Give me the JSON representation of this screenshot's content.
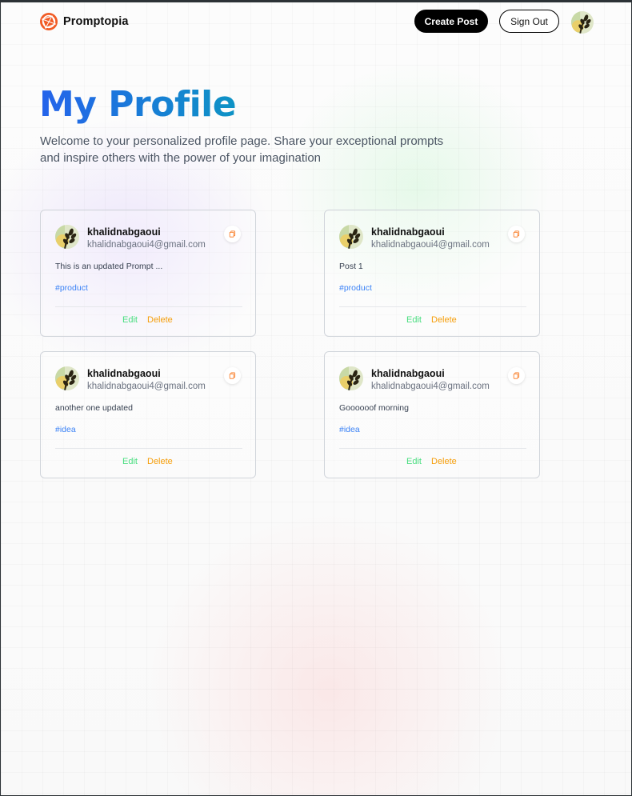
{
  "app": {
    "name": "Promptopia"
  },
  "nav": {
    "create_post_label": "Create Post",
    "sign_out_label": "Sign Out",
    "avatar_icon": "user-avatar-icon"
  },
  "header": {
    "title": "My Profile",
    "description": "Welcome to your personalized profile page. Share your exceptional prompts and inspire others with the power of your imagination"
  },
  "posts": [
    {
      "username": "khalidnabgaoui",
      "email": "khalidnabgaoui4@gmail.com",
      "prompt": "This is an updated Prompt ...",
      "tag": "#product",
      "edit_label": "Edit",
      "delete_label": "Delete"
    },
    {
      "username": "khalidnabgaoui",
      "email": "khalidnabgaoui4@gmail.com",
      "prompt": "Post 1",
      "tag": "#product",
      "edit_label": "Edit",
      "delete_label": "Delete"
    },
    {
      "username": "khalidnabgaoui",
      "email": "khalidnabgaoui4@gmail.com",
      "prompt": "another one updated",
      "tag": "#idea",
      "edit_label": "Edit",
      "delete_label": "Delete"
    },
    {
      "username": "khalidnabgaoui",
      "email": "khalidnabgaoui4@gmail.com",
      "prompt": "Goooooof morning",
      "tag": "#idea",
      "edit_label": "Edit",
      "delete_label": "Delete"
    }
  ],
  "colors": {
    "title_gradient_start": "#2563eb",
    "title_gradient_end": "#0e93c5",
    "tag": "#3b82f6",
    "edit": "#4ade80",
    "delete": "#f59e0b",
    "logo": "#f15a24"
  }
}
